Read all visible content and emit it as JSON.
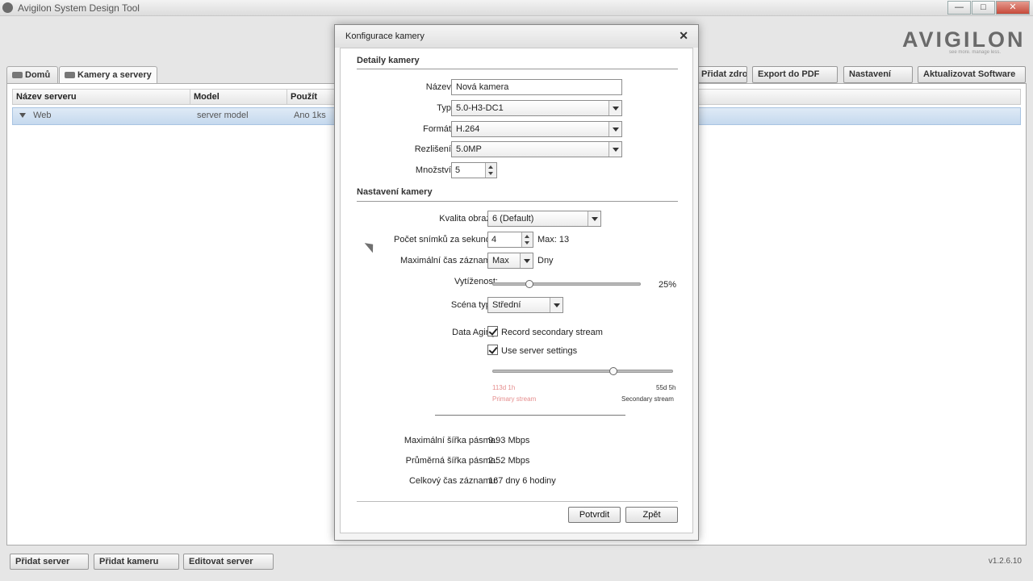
{
  "window": {
    "title": "Avigilon System Design Tool",
    "controls": [
      "—",
      "□",
      "✕"
    ]
  },
  "logo": {
    "text": "AVIGILON",
    "tagline": "see more. manage less."
  },
  "tabs": [
    {
      "label": "Domů"
    },
    {
      "label": "Kamery a servery"
    }
  ],
  "toolbar": {
    "buttons": [
      "Přidat zdroj",
      "Export do PDF",
      "Nastavení",
      "Aktualizovat Software"
    ]
  },
  "grid": {
    "columns": [
      "Název serveru",
      "Model",
      "Použít"
    ],
    "row": {
      "name": "Web",
      "model": "server model",
      "used": "Ano 1ks"
    }
  },
  "bottom": {
    "buttons": [
      "Přidat server",
      "Přidat kameru",
      "Editovat server"
    ],
    "version": "v1.2.6.10"
  },
  "dialog": {
    "title": "Konfigurace kamery",
    "close": "✕",
    "camera_details": {
      "heading": "Detaily kamery",
      "name_label": "Název:",
      "name_value": "Nová kamera",
      "type_label": "Typ:",
      "type_value": "5.0-H3-DC1",
      "format_label": "Formát:",
      "format_value": "H.264",
      "resolution_label": "Rezlišení:",
      "resolution_value": "5.0MP",
      "quantity_label": "Množství:",
      "quantity_value": "5"
    },
    "camera_settings": {
      "heading": "Nastavení kamery",
      "quality_label": "Kvalita obrazu:",
      "quality_value": "6 (Default)",
      "fps_label": "Počet snímků za sekundu:",
      "fps_value": "4",
      "fps_max": "Max: 13",
      "rec_time_label": "Maximální čas záznamu:",
      "rec_time_value": "Max",
      "rec_time_unit": "Dny",
      "load_label": "Vytíženost:",
      "load_value": "25%",
      "load_level_percent": 25,
      "scene_label": "Scéna typu:",
      "scene_value": "Střední",
      "aging_label": "Data Aging:",
      "record_secondary": "Record secondary stream",
      "use_server": "Use server settings",
      "aging_left_value": "113d 1h",
      "aging_left_label": "Primary stream",
      "aging_right_value": "55d 5h",
      "aging_right_label": "Secondary stream",
      "aging_split_percent": 67
    },
    "summary": {
      "max_bw_label": "Maximální šířka pásma:",
      "max_bw_value": "9.93 Mbps",
      "avg_bw_label": "Průměrná šířka pásma:",
      "avg_bw_value": "2.52 Mbps",
      "total_label": "Celkový čas záznamu:",
      "total_value": "167 dny 6 hodiny"
    },
    "confirm_label": "Potvrdit",
    "back_label": "Zpět"
  }
}
